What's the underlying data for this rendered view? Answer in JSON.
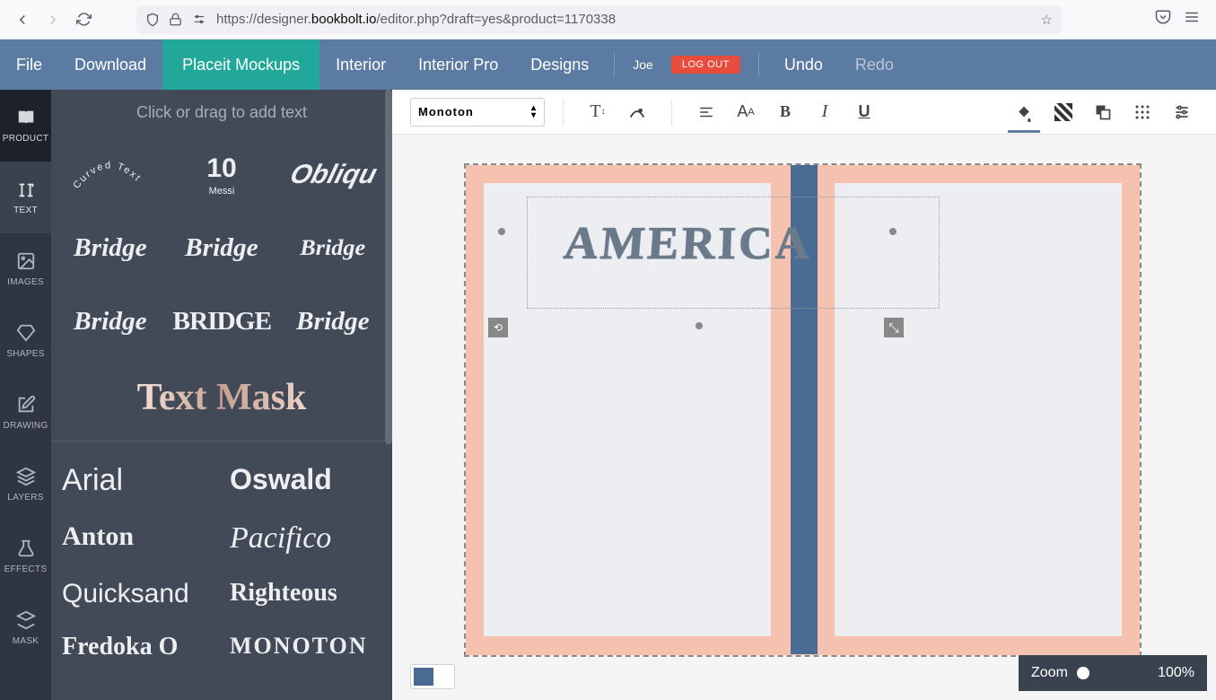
{
  "browser": {
    "url_prefix": "https://designer.",
    "url_domain": "bookbolt.io",
    "url_path": "/editor.php?draft=yes&product=1170338"
  },
  "menu": {
    "file": "File",
    "download": "Download",
    "placeit": "Placeit Mockups",
    "interior": "Interior",
    "interior_pro": "Interior Pro",
    "designs": "Designs",
    "user": "Joe",
    "logout": "LOG OUT",
    "undo": "Undo",
    "redo": "Redo"
  },
  "tools": {
    "product": "PRODUCT",
    "text": "TEXT",
    "images": "IMAGES",
    "shapes": "SHAPES",
    "drawing": "DRAWING",
    "layers": "LAYERS",
    "effects": "EFFECTS",
    "mask": "MASK"
  },
  "panel": {
    "header": "Click or drag to add text",
    "curved": "Curved Text",
    "ten": "10",
    "messi": "Messi",
    "oblique": "Obliqu",
    "bridge": "Bridge",
    "bridge_caps": "BRIDGE",
    "textmask": "Text Mask"
  },
  "fonts": {
    "arial": "Arial",
    "oswald": "Oswald",
    "anton": "Anton",
    "pacifico": "Pacifico",
    "quicksand": "Quicksand",
    "righteous": "Righteous",
    "fredoka": "Fredoka O",
    "monoton": "Monoton"
  },
  "toolbar": {
    "font": "Monoton",
    "aa": "Aa",
    "bold": "B",
    "italic": "I",
    "underline": "U"
  },
  "canvas": {
    "text": "AMERICA",
    "zoom_label": "Zoom",
    "zoom_value": "100%"
  }
}
